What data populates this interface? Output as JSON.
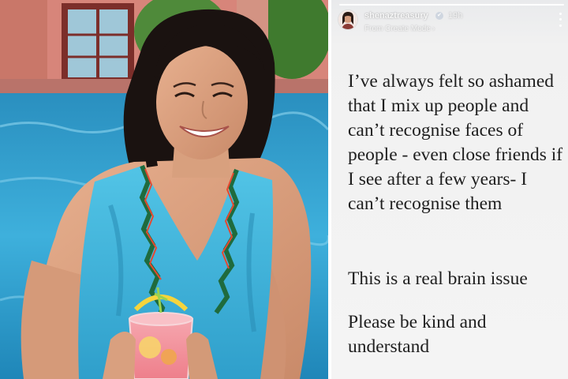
{
  "story": {
    "username": "shenaztreasury",
    "time": "19h",
    "subtitle": "From Create Mode",
    "icons": {
      "verified": "verified-badge-icon",
      "chevron": "chevron-right-icon",
      "more": "more-options-icon"
    },
    "paragraphs": [
      "I’ve always felt so ashamed that I mix up people and can’t recognise faces of people - even close friends if I see after a few years- I can’t recognise them",
      "This is a real brain issue",
      "Please be kind and understand"
    ]
  },
  "colors": {
    "pool_water": "#3aa7d6",
    "swimsuit": "#3cb6d8",
    "story_background": "#f3f3f3",
    "story_text": "#1e1e1e"
  }
}
